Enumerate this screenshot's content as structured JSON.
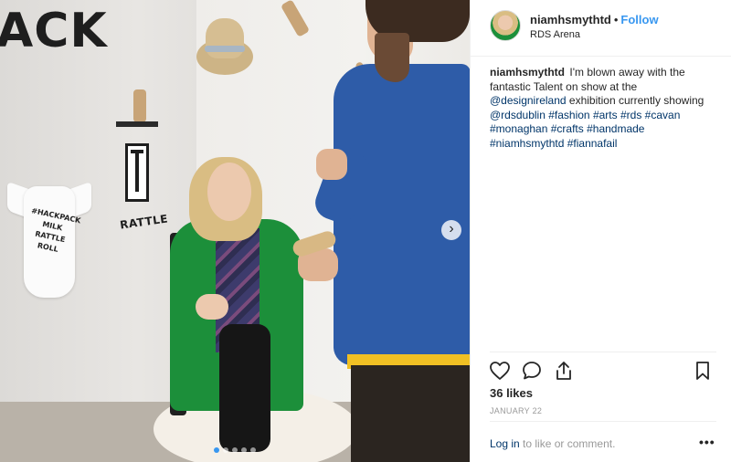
{
  "photo": {
    "sign_text": "ACK",
    "onesie_lines": [
      "#HACKPACK",
      "MILK",
      "RATTLE",
      "ROLL"
    ],
    "rattle_label": "RATTLE",
    "carousel_next": "›",
    "carousel_dots": 5,
    "carousel_active": 0
  },
  "header": {
    "username": "niamhsmythtd",
    "separator": "•",
    "follow_label": "Follow",
    "location": "RDS Arena"
  },
  "caption": {
    "username": "niamhsmythtd",
    "text_1": "I'm blown away with the fantastic Talent on show at the",
    "mention_1": "@designireland",
    "text_2": "exhibition currently showing",
    "mention_2": "@rdsdublin",
    "hashtags": [
      "#fashion",
      "#arts",
      "#rds",
      "#cavan",
      "#monaghan",
      "#crafts",
      "#handmade",
      "#niamhsmythtd",
      "#fiannafail"
    ]
  },
  "actions": {
    "like_icon": "heart-icon",
    "comment_icon": "comment-icon",
    "share_icon": "share-icon",
    "save_icon": "bookmark-icon"
  },
  "likes": "36 likes",
  "date": "JANUARY 22",
  "comment_bar": {
    "login_label": "Log in",
    "rest_text": "to like or comment.",
    "more_label": "•••"
  },
  "colors": {
    "link": "#003569",
    "follow": "#3897f0",
    "muted": "#999999"
  }
}
